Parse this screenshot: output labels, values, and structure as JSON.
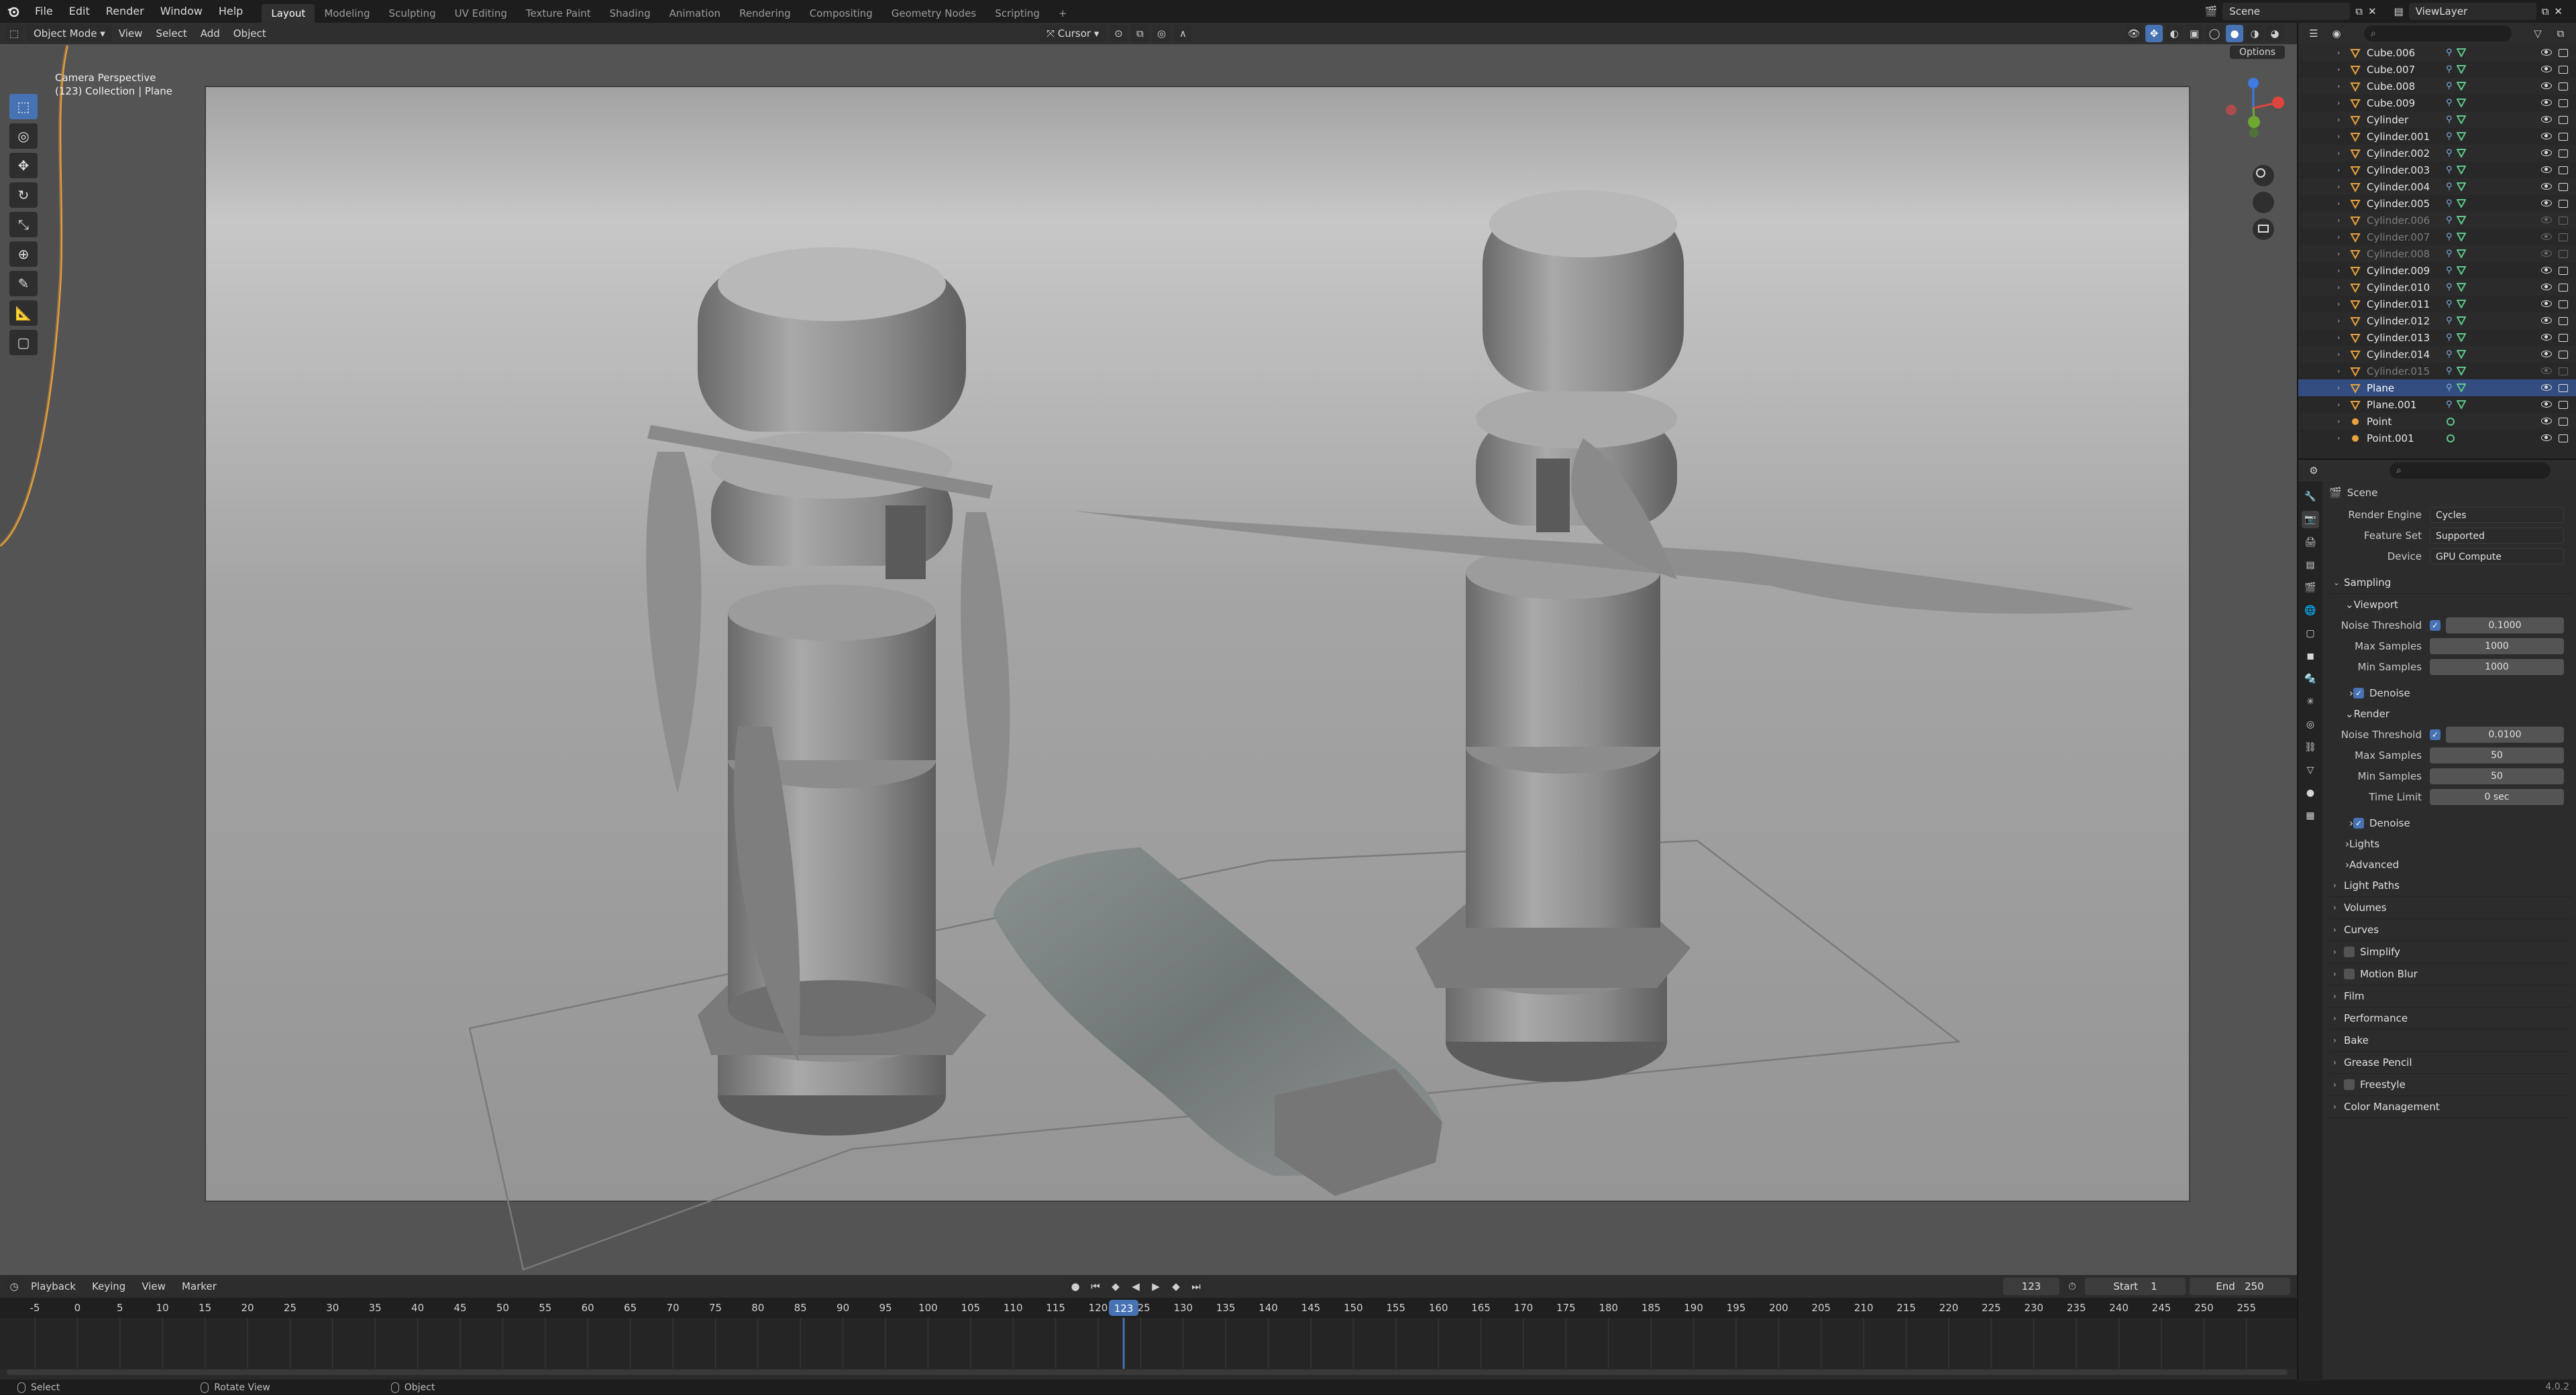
{
  "topbar": {
    "menus": [
      "File",
      "Edit",
      "Render",
      "Window",
      "Help"
    ],
    "workspaces": [
      "Layout",
      "Modeling",
      "Sculpting",
      "UV Editing",
      "Texture Paint",
      "Shading",
      "Animation",
      "Rendering",
      "Compositing",
      "Geometry Nodes",
      "Scripting"
    ],
    "active_workspace": "Layout",
    "add_tab": "+",
    "scene_name": "Scene",
    "view_layer": "ViewLayer"
  },
  "viewport": {
    "mode": "Object Mode",
    "menus": [
      "View",
      "Select",
      "Add",
      "Object"
    ],
    "pivot": "Cursor",
    "options_label": "Options",
    "info_line1": "Camera Perspective",
    "info_line2": "(123) Collection | Plane"
  },
  "timeline": {
    "menus": [
      "Playback",
      "Keying",
      "View",
      "Marker"
    ],
    "current_frame": "123",
    "start_label": "Start",
    "start_value": "1",
    "end_label": "End",
    "end_value": "250",
    "ruler_ticks": [
      "-5",
      "0",
      "5",
      "10",
      "15",
      "20",
      "25",
      "30",
      "35",
      "40",
      "45",
      "50",
      "55",
      "60",
      "65",
      "70",
      "75",
      "80",
      "85",
      "90",
      "95",
      "100",
      "105",
      "110",
      "115",
      "120",
      "125",
      "130",
      "135",
      "140",
      "145",
      "150",
      "155",
      "160",
      "165",
      "170",
      "175",
      "180",
      "185",
      "190",
      "195",
      "200",
      "205",
      "210",
      "215",
      "220",
      "225",
      "230",
      "235",
      "240",
      "245",
      "250",
      "255"
    ]
  },
  "statusbar": {
    "select": "Select",
    "rotate": "Rotate View",
    "object": "Object",
    "version": "4.0.2"
  },
  "outliner": {
    "search_placeholder": "",
    "items": [
      {
        "name": "Cube.006",
        "dim": false,
        "selected": false
      },
      {
        "name": "Cube.007",
        "dim": false,
        "selected": false
      },
      {
        "name": "Cube.008",
        "dim": false,
        "selected": false
      },
      {
        "name": "Cube.009",
        "dim": false,
        "selected": false
      },
      {
        "name": "Cylinder",
        "dim": false,
        "selected": false
      },
      {
        "name": "Cylinder.001",
        "dim": false,
        "selected": false
      },
      {
        "name": "Cylinder.002",
        "dim": false,
        "selected": false
      },
      {
        "name": "Cylinder.003",
        "dim": false,
        "selected": false
      },
      {
        "name": "Cylinder.004",
        "dim": false,
        "selected": false
      },
      {
        "name": "Cylinder.005",
        "dim": false,
        "selected": false
      },
      {
        "name": "Cylinder.006",
        "dim": true,
        "selected": false
      },
      {
        "name": "Cylinder.007",
        "dim": true,
        "selected": false
      },
      {
        "name": "Cylinder.008",
        "dim": true,
        "selected": false
      },
      {
        "name": "Cylinder.009",
        "dim": false,
        "selected": false
      },
      {
        "name": "Cylinder.010",
        "dim": false,
        "selected": false
      },
      {
        "name": "Cylinder.011",
        "dim": false,
        "selected": false
      },
      {
        "name": "Cylinder.012",
        "dim": false,
        "selected": false
      },
      {
        "name": "Cylinder.013",
        "dim": false,
        "selected": false
      },
      {
        "name": "Cylinder.014",
        "dim": false,
        "selected": false
      },
      {
        "name": "Cylinder.015",
        "dim": true,
        "selected": false
      },
      {
        "name": "Plane",
        "dim": false,
        "selected": true
      },
      {
        "name": "Plane.001",
        "dim": false,
        "selected": false
      },
      {
        "name": "Point",
        "dim": false,
        "selected": false
      },
      {
        "name": "Point.001",
        "dim": false,
        "selected": false
      }
    ]
  },
  "properties": {
    "scene_label": "Scene",
    "render_engine_label": "Render Engine",
    "render_engine": "Cycles",
    "feature_set_label": "Feature Set",
    "feature_set": "Supported",
    "device_label": "Device",
    "device": "GPU Compute",
    "sampling": "Sampling",
    "viewport": "Viewport",
    "noise_threshold_label": "Noise Threshold",
    "viewport_noise_threshold": "0.1000",
    "max_samples_label": "Max Samples",
    "viewport_max_samples": "1000",
    "min_samples_label": "Min Samples",
    "viewport_min_samples": "1000",
    "denoise": "Denoise",
    "render": "Render",
    "render_noise_threshold": "0.0100",
    "render_max_samples": "50",
    "render_min_samples": "50",
    "time_limit_label": "Time Limit",
    "time_limit": "0 sec",
    "lights": "Lights",
    "advanced": "Advanced",
    "sections": [
      "Light Paths",
      "Volumes",
      "Curves",
      "Simplify",
      "Motion Blur",
      "Film",
      "Performance",
      "Bake",
      "Grease Pencil",
      "Freestyle",
      "Color Management"
    ]
  },
  "colors": {
    "accent": "#4772b3",
    "object_orange": "#e8a13c",
    "mesh_green": "#5fc88a",
    "axis_x": "#e0443e",
    "axis_y": "#6fa831",
    "axis_z": "#3d7be0"
  }
}
